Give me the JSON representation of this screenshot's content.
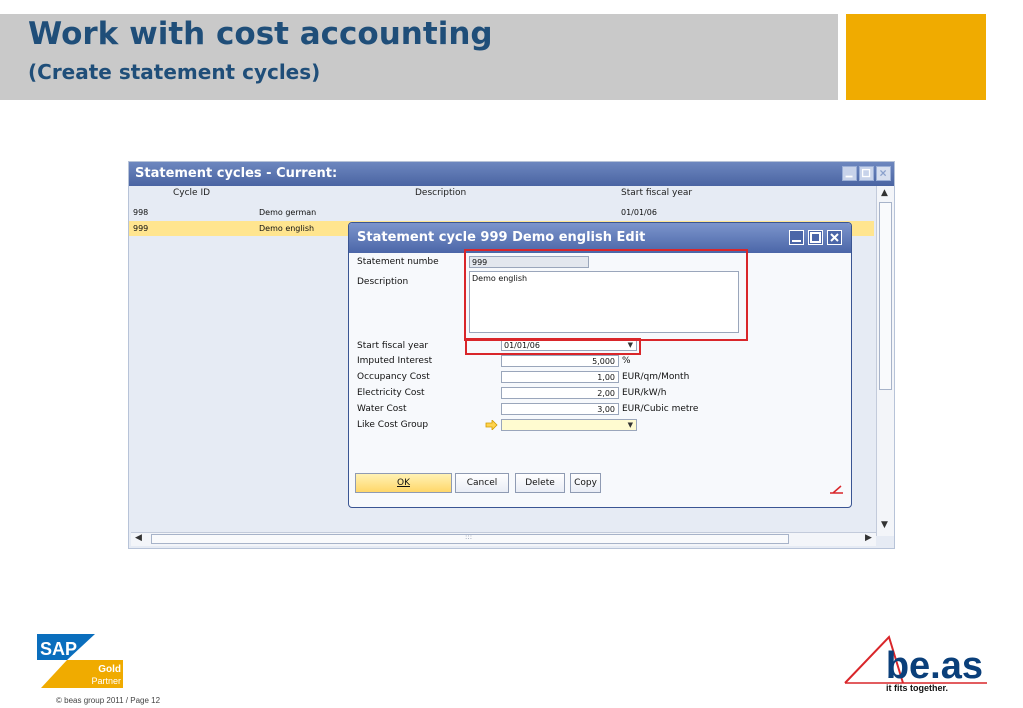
{
  "slide": {
    "title": "Work with cost accounting",
    "subtitle": "(Create statement cycles)",
    "footer": "© beas group 2011 / Page 12",
    "colors": {
      "title": "#1f4e79",
      "header_band": "#c9c9c9",
      "accent": "#f0ab00",
      "highlight_box": "#d9262a"
    }
  },
  "list_window": {
    "title": "Statement cycles -  Current:",
    "columns": [
      "Cycle ID",
      "Description",
      "Start fiscal year"
    ],
    "rows": [
      {
        "id": "998",
        "description": "Demo german",
        "start": "01/01/06",
        "selected": false
      },
      {
        "id": "999",
        "description": "Demo english",
        "start": "",
        "selected": true
      }
    ],
    "scroll_hint": ":::"
  },
  "dialog": {
    "title": "Statement cycle 999 Demo english Edit",
    "fields": {
      "statement_number": {
        "label": "Statement numbe",
        "value": "999"
      },
      "description": {
        "label": "Description",
        "value": "Demo english"
      },
      "start_fiscal_year": {
        "label": "Start fiscal year",
        "value": "01/01/06"
      },
      "imputed_interest": {
        "label": "Imputed Interest",
        "value": "5,000",
        "unit": "%"
      },
      "occupancy_cost": {
        "label": "Occupancy Cost",
        "value": "1,00",
        "unit": "EUR/qm/Month"
      },
      "electricity_cost": {
        "label": "Electricity Cost",
        "value": "2,00",
        "unit": "EUR/kW/h"
      },
      "water_cost": {
        "label": "Water Cost",
        "value": "3,00",
        "unit": "EUR/Cubic metre"
      },
      "like_cost_group": {
        "label": "Like Cost Group",
        "value": ""
      }
    },
    "buttons": {
      "ok": "OK",
      "cancel": "Cancel",
      "delete": "Delete",
      "copy": "Copy"
    }
  },
  "logos": {
    "sap_text": "SAP",
    "sap_gold": "Gold",
    "sap_partner": "Partner",
    "beas_text": "be.as",
    "beas_tagline": "it fits together."
  }
}
